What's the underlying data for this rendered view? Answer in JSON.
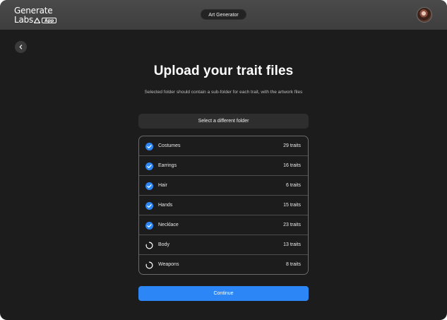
{
  "app": {
    "logo_line1": "Generate",
    "logo_line2": "Labs",
    "logo_badge": "App",
    "section_pill": "Art Generator",
    "accent_color": "#2d86f5"
  },
  "header": {
    "back_icon": "chevron-left-icon",
    "avatar_icon": "user-avatar"
  },
  "main": {
    "title": "Upload your trait files",
    "subtitle": "Selected folder should contain a sub-folder for each trait, with the artwork files",
    "select_folder_label": "Select a different folder",
    "continue_label": "Continue"
  },
  "traits": [
    {
      "name": "Costumes",
      "count": "29 traits",
      "status": "done"
    },
    {
      "name": "Earrings",
      "count": "16 traits",
      "status": "done"
    },
    {
      "name": "Hair",
      "count": "6 traits",
      "status": "done"
    },
    {
      "name": "Hands",
      "count": "15 traits",
      "status": "done"
    },
    {
      "name": "Necklace",
      "count": "23 traits",
      "status": "done"
    },
    {
      "name": "Body",
      "count": "13 traits",
      "status": "loading"
    },
    {
      "name": "Weapons",
      "count": "8 traits",
      "status": "loading"
    }
  ]
}
